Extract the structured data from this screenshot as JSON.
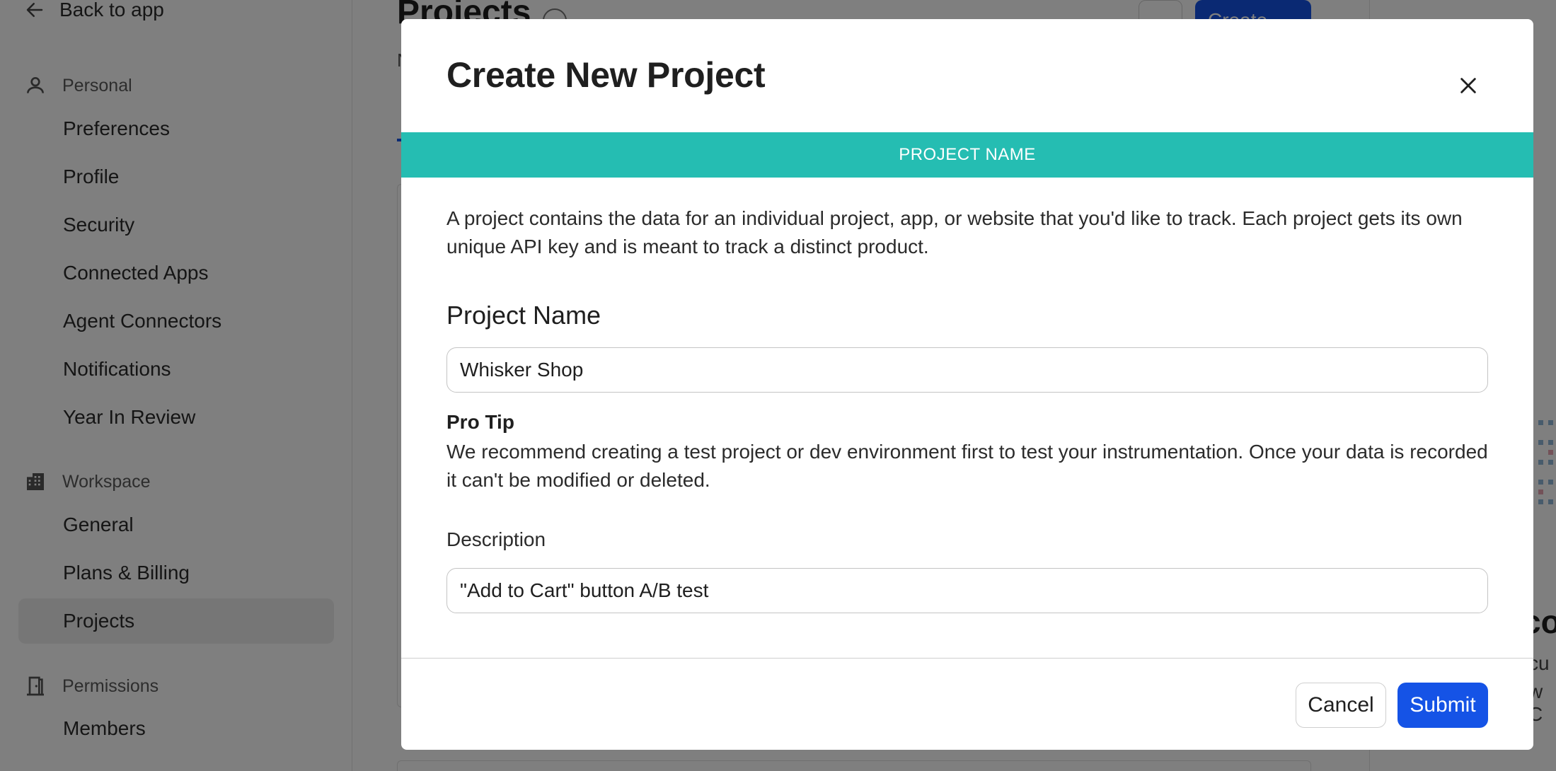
{
  "sidebar": {
    "back_label": "Back to app",
    "sections": {
      "personal": {
        "label": "Personal",
        "items": [
          "Preferences",
          "Profile",
          "Security",
          "Connected Apps",
          "Agent Connectors",
          "Notifications",
          "Year In Review"
        ]
      },
      "workspace": {
        "label": "Workspace",
        "items": [
          "General",
          "Plans & Billing",
          "Projects"
        ]
      },
      "permissions": {
        "label": "Permissions",
        "items": [
          "Members"
        ]
      }
    },
    "active_item": "Projects"
  },
  "main": {
    "title": "Projects",
    "create_label": "Create"
  },
  "modal": {
    "title": "Create New Project",
    "step_banner": "PROJECT NAME",
    "intro": "A project contains the data for an individual project, app, or website that you'd like to track. Each project gets its own unique API key and is meant to track a distinct product.",
    "project_name_label": "Project Name",
    "project_name_value": "Whisker Shop",
    "pro_tip_title": "Pro Tip",
    "pro_tip_text": "We recommend creating a test project or dev environment first to test your instrumentation. Once your data is recorded it can't be modified or deleted.",
    "description_label": "Description",
    "description_value": "\"Add to Cart\" button A/B test",
    "cancel_label": "Cancel",
    "submit_label": "Submit"
  },
  "colors": {
    "accent": "#1553e6",
    "banner": "#25bdb2",
    "overlay": "rgba(0,0,0,0.5)"
  }
}
